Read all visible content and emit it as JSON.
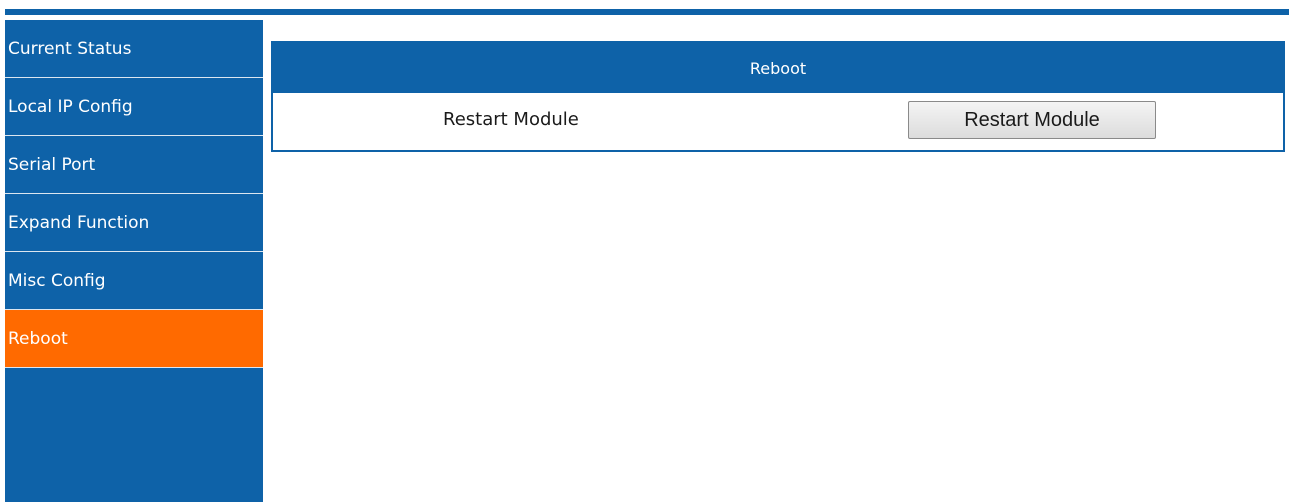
{
  "sidebar": {
    "items": [
      {
        "label": "Current Status",
        "active": false
      },
      {
        "label": "Local IP Config",
        "active": false
      },
      {
        "label": "Serial Port",
        "active": false
      },
      {
        "label": "Expand Function",
        "active": false
      },
      {
        "label": "Misc Config",
        "active": false
      },
      {
        "label": "Reboot",
        "active": true
      }
    ]
  },
  "panel": {
    "title": "Reboot",
    "row_label": "Restart Module",
    "button_label": "Restart Module"
  },
  "colors": {
    "brand_blue": "#0e62a8",
    "active_orange": "#ff6a00",
    "background": "#ffffff"
  }
}
